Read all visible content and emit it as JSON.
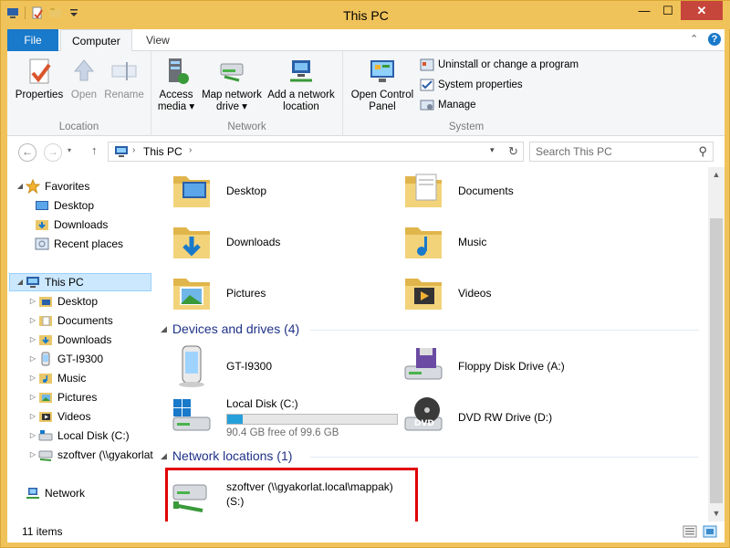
{
  "window": {
    "title": "This PC"
  },
  "titlebar": {
    "minimize": "—",
    "maximize": "☐",
    "close": "✕"
  },
  "ribbon_tabs": {
    "file": "File",
    "computer": "Computer",
    "view": "View"
  },
  "ribbon_controls": {
    "collapse": "⌃",
    "help": "?"
  },
  "ribbon": {
    "location": {
      "label": "Location",
      "properties": "Properties",
      "open": "Open",
      "rename": "Rename"
    },
    "network": {
      "label": "Network",
      "access_media_line1": "Access",
      "access_media_line2": "media ▾",
      "map_drive_line1": "Map network",
      "map_drive_line2": "drive ▾",
      "add_location_line1": "Add a network",
      "add_location_line2": "location"
    },
    "system": {
      "label": "System",
      "control_panel_line1": "Open Control",
      "control_panel_line2": "Panel",
      "uninstall": "Uninstall or change a program",
      "system_properties": "System properties",
      "manage": "Manage"
    }
  },
  "navbar": {
    "back": "←",
    "forward": "→",
    "up": "↑",
    "path": "This PC",
    "search_placeholder": "Search This PC"
  },
  "nav_pane": {
    "favorites": "Favorites",
    "desktop": "Desktop",
    "downloads": "Downloads",
    "recent": "Recent places",
    "this_pc": "This PC",
    "pc_desktop": "Desktop",
    "pc_documents": "Documents",
    "pc_downloads": "Downloads",
    "pc_phone": "GT-I9300",
    "pc_music": "Music",
    "pc_pictures": "Pictures",
    "pc_videos": "Videos",
    "pc_local": "Local Disk (C:)",
    "pc_net": "szoftver (\\\\gyakorlat.local\\mappak)",
    "network": "Network"
  },
  "folders": {
    "desktop": "Desktop",
    "documents": "Documents",
    "downloads": "Downloads",
    "music": "Music",
    "pictures": "Pictures",
    "videos": "Videos"
  },
  "devices": {
    "header": "Devices and drives (4)",
    "phone": "GT-I9300",
    "floppy": "Floppy Disk Drive (A:)",
    "local_disk": "Local Disk (C:)",
    "local_disk_free": "90.4 GB free of 99.6 GB",
    "local_disk_used_fraction": 0.092,
    "dvd": "DVD RW Drive (D:)"
  },
  "network_locations": {
    "header": "Network locations (1)",
    "share_line1": "szoftver (\\\\gyakorlat.local\\mappak)",
    "share_line2": "(S:)"
  },
  "status": {
    "items": "11 items"
  },
  "colors": {
    "highlight": "#e00000",
    "accent": "#1979ca",
    "frame": "#f0c35a"
  }
}
